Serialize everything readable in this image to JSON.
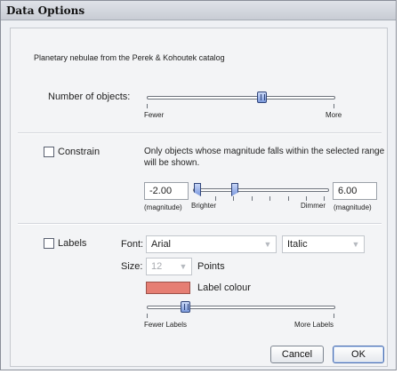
{
  "window": {
    "title": "Data Options"
  },
  "description": "Planetary nebulae from the Perek & Kohoutek catalog",
  "objects": {
    "label": "Number of objects:",
    "left_label": "Fewer",
    "right_label": "More",
    "level": 0.6
  },
  "constrain": {
    "label": "Constrain",
    "checked": false,
    "text_line1": "Only objects whose magnitude falls within the selected range",
    "text_line2": "will be shown.",
    "min_value": "-2.00",
    "max_value": "6.00",
    "min_unit": "(magnitude)",
    "max_unit": "(magnitude)",
    "brighter_label": "Brighter",
    "dimmer_label": "Dimmer"
  },
  "labels": {
    "label": "Labels",
    "checked": false,
    "font_label": "Font:",
    "font_value": "Arial",
    "style_value": "Italic",
    "size_label": "Size:",
    "size_value": "12",
    "size_unit": "Points",
    "colour_label": "Label colour",
    "colour": "#e67e73",
    "fewer_label": "Fewer Labels",
    "more_label": "More Labels",
    "level": 0.21
  },
  "buttons": {
    "cancel": "Cancel",
    "ok": "OK"
  }
}
